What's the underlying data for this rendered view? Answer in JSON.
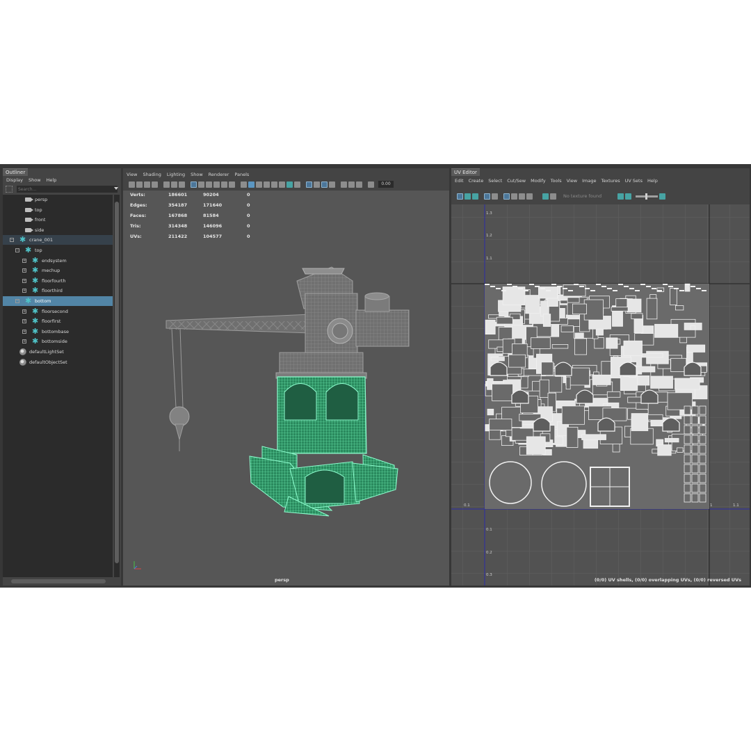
{
  "outliner": {
    "tab_label": "Outliner",
    "menu": [
      "Display",
      "Show",
      "Help"
    ],
    "search_placeholder": "Search...",
    "items": [
      {
        "label": "persp",
        "icon": "camera-icon",
        "indent": 1
      },
      {
        "label": "top",
        "icon": "camera-icon",
        "indent": 1
      },
      {
        "label": "front",
        "icon": "camera-icon",
        "indent": 1
      },
      {
        "label": "side",
        "icon": "camera-icon",
        "indent": 1
      },
      {
        "label": "crane_001",
        "icon": "joint-icon",
        "indent": 0,
        "expander": "⊟",
        "state": "selected-parent"
      },
      {
        "label": "top",
        "icon": "joint-icon",
        "indent": 1,
        "expander": "⊟"
      },
      {
        "label": "endsystem",
        "icon": "joint-icon",
        "indent": 2,
        "expander": "⊞"
      },
      {
        "label": "mechup",
        "icon": "joint-icon",
        "indent": 2,
        "expander": "⊞"
      },
      {
        "label": "floorfourth",
        "icon": "joint-icon",
        "indent": 2,
        "expander": "⊞"
      },
      {
        "label": "floorthird",
        "icon": "joint-icon",
        "indent": 2,
        "expander": "⊞"
      },
      {
        "label": "bottom",
        "icon": "joint-icon",
        "indent": 1,
        "expander": "⊟",
        "state": "selected"
      },
      {
        "label": "floorsecond",
        "icon": "joint-icon",
        "indent": 2,
        "expander": "⊞"
      },
      {
        "label": "floorfirst",
        "icon": "joint-icon",
        "indent": 2,
        "expander": "⊞"
      },
      {
        "label": "bottombase",
        "icon": "joint-icon",
        "indent": 2,
        "expander": "⊞"
      },
      {
        "label": "bottomside",
        "icon": "joint-icon",
        "indent": 2,
        "expander": "⊞"
      },
      {
        "label": "defaultLightSet",
        "icon": "set-icon",
        "indent": 0
      },
      {
        "label": "defaultObjectSet",
        "icon": "set-icon",
        "indent": 0
      }
    ]
  },
  "viewport": {
    "menu": [
      "View",
      "Shading",
      "Lighting",
      "Show",
      "Renderer",
      "Panels"
    ],
    "zoom_value": "0.00",
    "camera_label": "persp",
    "hud": [
      {
        "label": "Verts:",
        "total": "186601",
        "selected": "90204",
        "other": "0"
      },
      {
        "label": "Edges:",
        "total": "354187",
        "selected": "171640",
        "other": "0"
      },
      {
        "label": "Faces:",
        "total": "167868",
        "selected": "81584",
        "other": "0"
      },
      {
        "label": "Tris:",
        "total": "314348",
        "selected": "146096",
        "other": "0"
      },
      {
        "label": "UVs:",
        "total": "211422",
        "selected": "104577",
        "other": "0"
      }
    ],
    "highlight_color": "#3de39a"
  },
  "uv_editor": {
    "tab_label": "UV Editor",
    "menu": [
      "Edit",
      "Create",
      "Select",
      "Cut/Sew",
      "Modify",
      "Tools",
      "View",
      "Image",
      "Textures",
      "UV Sets",
      "Help"
    ],
    "texture_status": "No texture found",
    "status": "(0/0) UV shells, (0/0) overlapping UVs, (0/0) reversed UVs",
    "axis_labels_v": [
      "1.3",
      "1.2",
      "1.1",
      "0.1",
      "0.2",
      "0.3"
    ],
    "axis_labels_u": [
      "0.1",
      "1",
      "1.1"
    ]
  }
}
